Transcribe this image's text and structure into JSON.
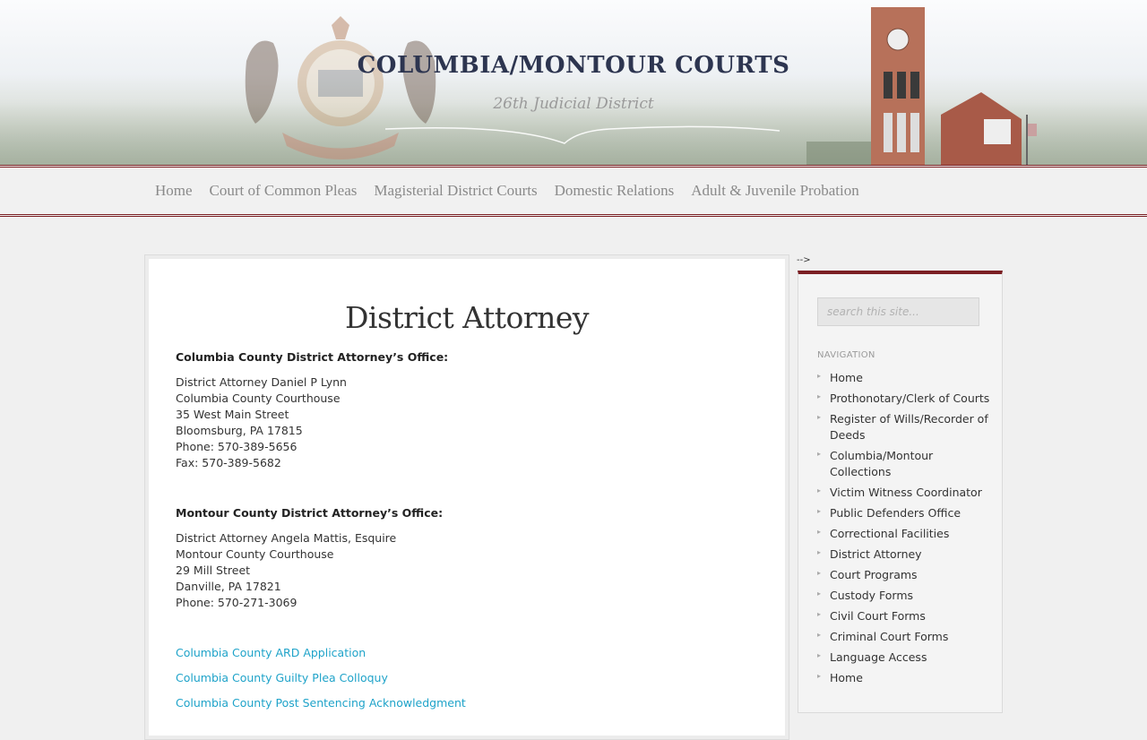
{
  "header": {
    "title": "COLUMBIA/MONTOUR COURTS",
    "subtitle": "26th Judicial District"
  },
  "nav": {
    "items": [
      "Home",
      "Court of Common Pleas",
      "Magisterial District Courts",
      "Domestic Relations",
      "Adult & Juvenile Probation"
    ]
  },
  "main": {
    "page_title": "District Attorney",
    "columbia": {
      "heading": "Columbia County District Attorney’s Office:",
      "lines": [
        "District Attorney Daniel P Lynn",
        "Columbia County Courthouse",
        "35 West Main Street",
        "Bloomsburg, PA 17815",
        "Phone:  570-389-5656",
        "Fax: 570-389-5682"
      ]
    },
    "montour": {
      "heading": "Montour County District Attorney’s Office:",
      "lines": [
        "District Attorney Angela Mattis, Esquire",
        "Montour County Courthouse",
        "29 Mill Street",
        "Danville, PA 17821",
        "Phone: 570-271-3069"
      ]
    },
    "links": [
      "Columbia County ARD Application",
      "Columbia County Guilty Plea Colloquy",
      "Columbia County Post Sentencing Acknowledgment"
    ]
  },
  "stray_text": "-->",
  "sidebar": {
    "search_placeholder": "search this site...",
    "nav_heading": "NAVIGATION",
    "items": [
      "Home",
      "Prothonotary/Clerk of Courts",
      "Register of Wills/Recorder of Deeds",
      "Columbia/Montour Collections",
      "Victim Witness Coordinator",
      "Public Defenders Office",
      "Correctional Facilities",
      "District Attorney",
      "Court Programs",
      "Custody Forms",
      "Civil Court Forms",
      "Criminal Court Forms",
      "Language Access",
      "Home"
    ]
  },
  "colors": {
    "accent": "#7b1f23",
    "link": "#1fa3c9",
    "title": "#2d3550"
  }
}
